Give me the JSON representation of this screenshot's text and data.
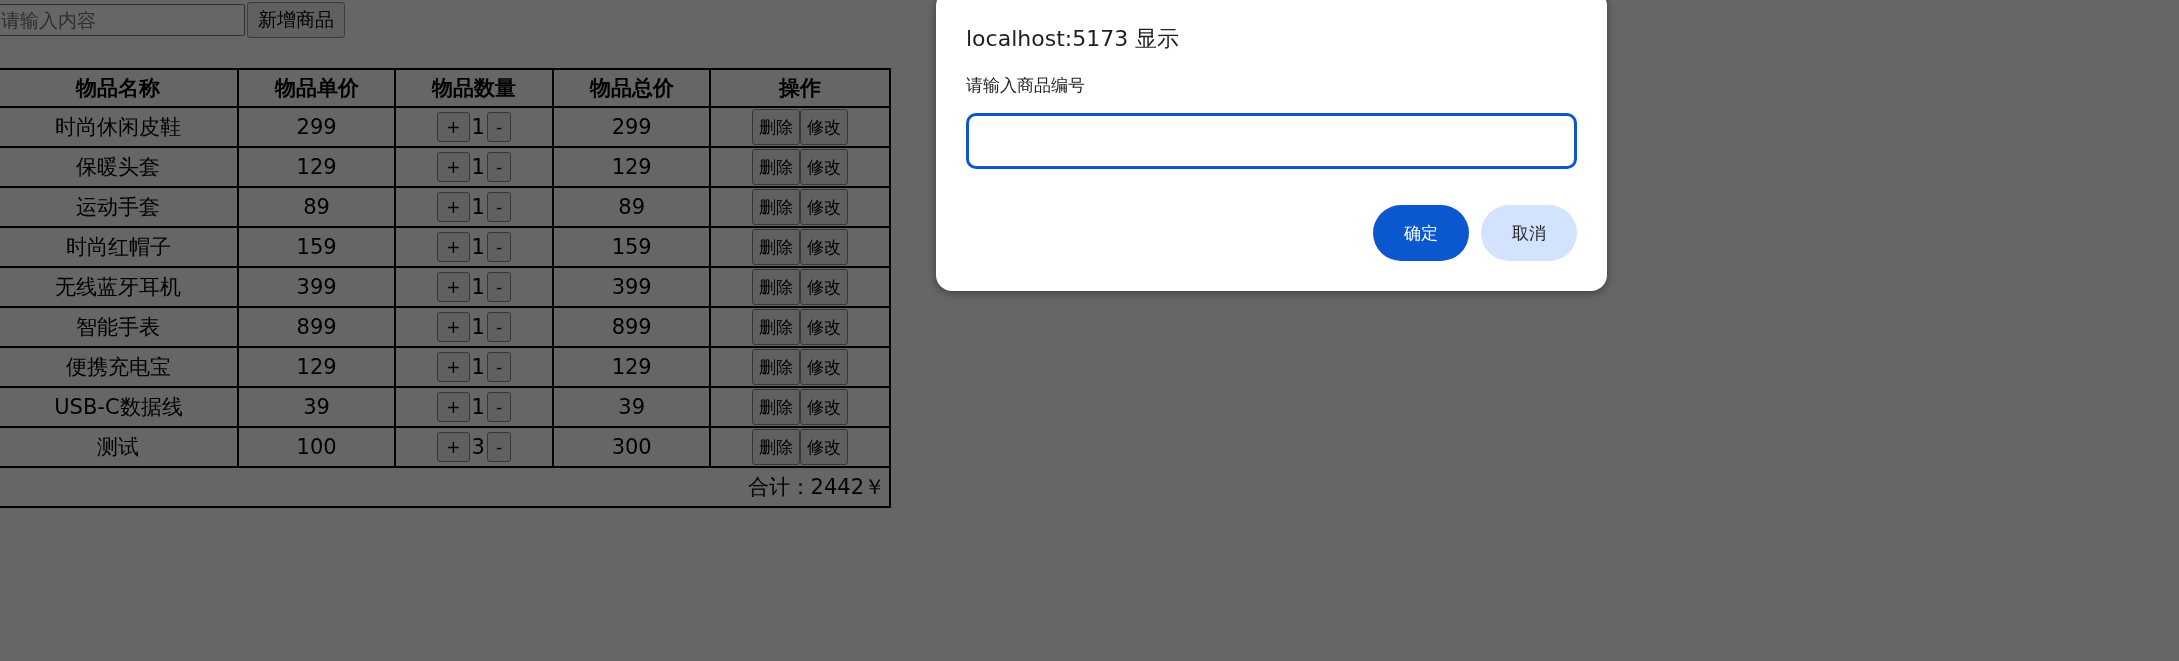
{
  "search": {
    "placeholder": "请输入内容"
  },
  "add_button": "新增商品",
  "table": {
    "columns": [
      "物品名称",
      "物品单价",
      "物品数量",
      "物品总价",
      "操作"
    ],
    "rows": [
      {
        "name": "时尚休闲皮鞋",
        "price": "299",
        "increment": "+",
        "quantity": "1",
        "decrement": "-",
        "total": "299",
        "delete": "删除",
        "edit": "修改"
      },
      {
        "name": "保暖头套",
        "price": "129",
        "increment": "+",
        "quantity": "1",
        "decrement": "-",
        "total": "129",
        "delete": "删除",
        "edit": "修改"
      },
      {
        "name": "运动手套",
        "price": "89",
        "increment": "+",
        "quantity": "1",
        "decrement": "-",
        "total": "89",
        "delete": "删除",
        "edit": "修改"
      },
      {
        "name": "时尚红帽子",
        "price": "159",
        "increment": "+",
        "quantity": "1",
        "decrement": "-",
        "total": "159",
        "delete": "删除",
        "edit": "修改"
      },
      {
        "name": "无线蓝牙耳机",
        "price": "399",
        "increment": "+",
        "quantity": "1",
        "decrement": "-",
        "total": "399",
        "delete": "删除",
        "edit": "修改"
      },
      {
        "name": "智能手表",
        "price": "899",
        "increment": "+",
        "quantity": "1",
        "decrement": "-",
        "total": "899",
        "delete": "删除",
        "edit": "修改"
      },
      {
        "name": "便携充电宝",
        "price": "129",
        "increment": "+",
        "quantity": "1",
        "decrement": "-",
        "total": "129",
        "delete": "删除",
        "edit": "修改"
      },
      {
        "name": "USB-C数据线",
        "price": "39",
        "increment": "+",
        "quantity": "1",
        "decrement": "-",
        "total": "39",
        "delete": "删除",
        "edit": "修改"
      },
      {
        "name": "测试",
        "price": "100",
        "increment": "+",
        "quantity": "3",
        "decrement": "-",
        "total": "300",
        "delete": "删除",
        "edit": "修改"
      }
    ],
    "footer": "合计：2442￥"
  },
  "dialog": {
    "title": "localhost:5173 显示",
    "message": "请输入商品编号",
    "input": {
      "focused": true
    },
    "buttons": [
      {
        "label": "确定",
        "kind": "primary"
      },
      {
        "label": "取消",
        "kind": "secondary"
      }
    ]
  }
}
